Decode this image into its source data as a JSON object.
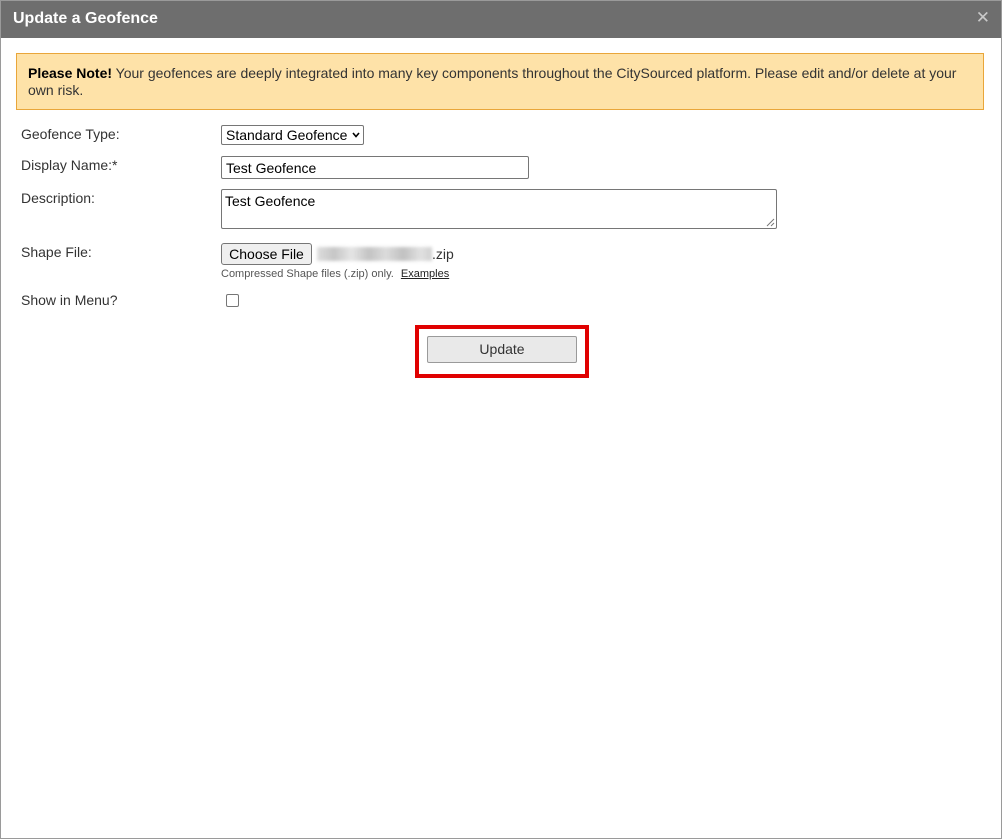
{
  "dialog": {
    "title": "Update a Geofence",
    "close_glyph": "✕"
  },
  "notice": {
    "bold": "Please Note!",
    "text": " Your geofences are deeply integrated into many key components throughout the CitySourced platform. Please edit and/or delete at your own risk."
  },
  "form": {
    "type_label": "Geofence Type:",
    "type_value": "Standard Geofence",
    "name_label": "Display Name:*",
    "name_value": "Test Geofence",
    "desc_label": "Description:",
    "desc_value": "Test Geofence",
    "shape_label": "Shape File:",
    "choose_file_label": "Choose File",
    "file_ext": ".zip",
    "hint_text": "Compressed Shape files (.zip) only.",
    "examples_link": "Examples",
    "menu_label": "Show in Menu?",
    "menu_checked": false
  },
  "actions": {
    "update_label": "Update"
  },
  "icons": {
    "close": "close-icon",
    "dropdown": "chevron-down-icon"
  },
  "colors": {
    "titlebar": "#6e6e6e",
    "notice_bg": "#fee2a8",
    "notice_border": "#e9a63a",
    "highlight": "#e00000"
  }
}
